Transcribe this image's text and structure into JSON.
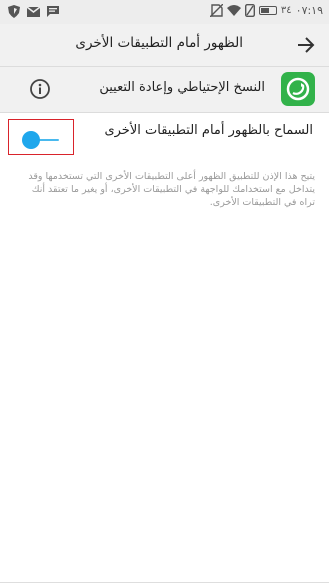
{
  "status_bar": {
    "time": "٠٧:١٩",
    "battery_percent": "٣٤",
    "left_icons": [
      "shield-icon",
      "gmail-icon",
      "messages-icon"
    ],
    "right_icons": [
      "no-sim-icon",
      "wifi-icon",
      "battery-icon"
    ]
  },
  "toolbar": {
    "title": "الظهور أمام التطبيقات الأخرى",
    "back_icon": "arrow-right-icon"
  },
  "app": {
    "name": "النسخ الإحتياطي وإعادة التعيين",
    "icon": "backup-app-icon",
    "icon_color": "#32b24a",
    "info_icon": "info-icon"
  },
  "setting": {
    "label": "السماح بالظهور أمام التطبيقات الأخرى",
    "toggle_state": "on",
    "toggle_color": "#1fa7ec",
    "highlight_color": "#d9232b"
  },
  "description": "يتيح هذا الإذن للتطبيق الظهور أعلى التطبيقات الأخرى التي تستخدمها وقد يتداخل مع استخدامك للواجهة في التطبيقات الأخرى، أو يغير ما تعتقد أنك تراه في التطبيقات الأخرى."
}
